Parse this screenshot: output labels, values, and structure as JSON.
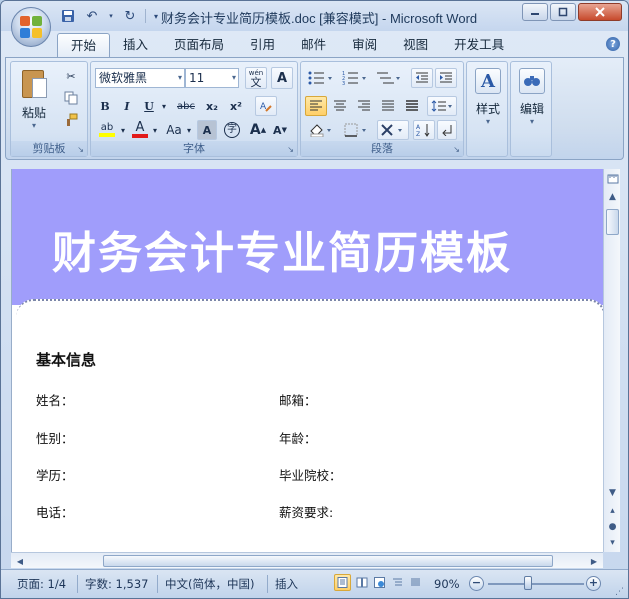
{
  "window": {
    "title": "财务会计专业简历模板.doc [兼容模式] - Microsoft Word"
  },
  "qat": {
    "save_icon": "save-icon",
    "undo_icon": "undo-icon",
    "redo_icon": "redo-icon"
  },
  "tabs": [
    {
      "label": "开始",
      "active": true
    },
    {
      "label": "插入"
    },
    {
      "label": "页面布局"
    },
    {
      "label": "引用"
    },
    {
      "label": "邮件"
    },
    {
      "label": "审阅"
    },
    {
      "label": "视图"
    },
    {
      "label": "开发工具"
    }
  ],
  "ribbon": {
    "clipboard": {
      "label": "剪贴板",
      "paste_label": "粘贴"
    },
    "font": {
      "label": "字体",
      "font_name": "微软雅黑",
      "font_size": "11",
      "phonetic_label": "wén",
      "phonetic_char": "文",
      "char_border": "A",
      "bold": "B",
      "italic": "I",
      "underline": "U",
      "strikethrough": "abc",
      "subscript": "x₂",
      "superscript": "x²",
      "highlight": "ab",
      "font_color": "A",
      "change_case": "Aa",
      "char_shading": "A",
      "enclose_char": "字",
      "grow_font": "A",
      "shrink_font": "A"
    },
    "paragraph": {
      "label": "段落"
    },
    "styles": {
      "label": "样式"
    },
    "editing": {
      "label": "编辑"
    }
  },
  "document": {
    "banner_title": "财务会计专业简历模板",
    "banner_color": "#a09dfb",
    "section_title": "基本信息",
    "fields": {
      "name": "姓名：",
      "email": "邮箱：",
      "gender": "性别：",
      "age": "年龄：",
      "education": "学历：",
      "school": "毕业院校：",
      "phone": "电话：",
      "salary": "薪资要求:"
    }
  },
  "statusbar": {
    "page": "页面: 1/4",
    "words": "字数: 1,537",
    "language": "中文(简体，中国)",
    "mode": "插入",
    "zoom": "90%",
    "zoom_level_percent": 90
  }
}
